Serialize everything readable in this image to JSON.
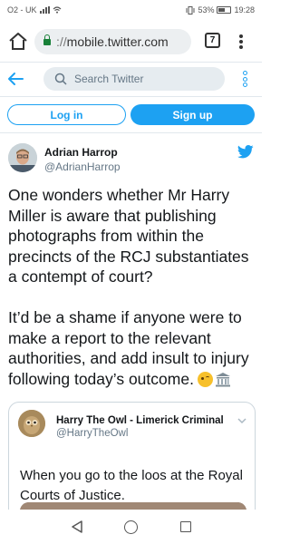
{
  "status_bar": {
    "carrier": "O2 - UK",
    "battery": "53%",
    "time": "19:28"
  },
  "browser": {
    "url_scheme": "://",
    "url_host": "mobile.twitter.com",
    "tab_count": "7",
    "accent": "#188038"
  },
  "twitter_header": {
    "search_placeholder": "Search Twitter"
  },
  "auth": {
    "login_label": "Log in",
    "signup_label": "Sign up",
    "accent": "#1da1f2"
  },
  "tweet": {
    "author_name": "Adrian Harrop",
    "author_handle": "@AdrianHarrop",
    "paragraph_1": "One wonders whether Mr Harry Miller is aware that publishing photographs from within the precincts of the RCJ substantiates a contempt of court?",
    "paragraph_2": "It’d be a shame if anyone were to make a report to the relevant authorities, and add insult to injury following today’s outcome.",
    "emojis": [
      "winking-face",
      "classical-building"
    ]
  },
  "quoted_tweet": {
    "author_name": "Harry The Owl - Limerick Criminal",
    "author_handle": "@HarryTheOwl",
    "text": "When you go to the loos at the Royal Courts of Justice."
  },
  "nav": {
    "buttons": [
      "back",
      "home",
      "recents"
    ]
  }
}
